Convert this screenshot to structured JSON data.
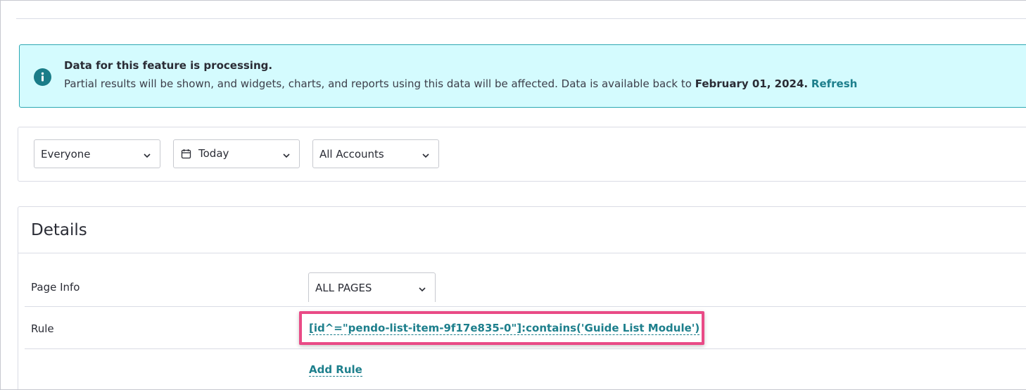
{
  "banner": {
    "title": "Data for this feature is processing.",
    "text_prefix": "Partial results will be shown, and widgets, charts, and reports using this data will be affected. Data is available back to",
    "date": "February 01, 2024.",
    "refresh_label": "Refresh",
    "icon": "info-icon",
    "accent_color": "#1a7c88"
  },
  "filters": {
    "segment": {
      "value": "Everyone",
      "icon": "chevron-down-icon"
    },
    "date_range": {
      "value": "Today",
      "icon": "calendar-icon"
    },
    "accounts": {
      "value": "All Accounts",
      "icon": "chevron-down-icon"
    }
  },
  "details": {
    "title": "Details",
    "page_info_label": "Page Info",
    "page_select_value": "ALL PAGES",
    "rule_label": "Rule",
    "rule_value": "[id^=\"pendo-list-item-9f17e835-0\"]:contains('Guide List Module')",
    "add_rule_label": "Add Rule",
    "highlight_color": "#e94a86",
    "link_color": "#1d7f8c"
  }
}
